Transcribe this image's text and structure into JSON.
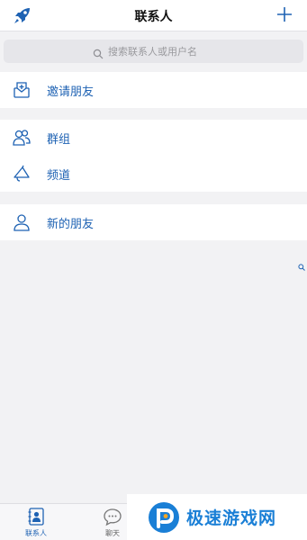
{
  "navbar": {
    "title": "联系人",
    "left_icon": "rocket-icon",
    "right_icon": "plus-icon"
  },
  "search": {
    "placeholder": "搜索联系人或用户名"
  },
  "sections": [
    {
      "items": [
        {
          "label": "邀请朋友",
          "icon": "invite-inbox-icon"
        }
      ]
    },
    {
      "items": [
        {
          "label": "群组",
          "icon": "group-users-icon"
        },
        {
          "label": "频道",
          "icon": "megaphone-icon"
        }
      ]
    },
    {
      "items": [
        {
          "label": "新的朋友",
          "icon": "person-icon"
        }
      ]
    }
  ],
  "tabbar": {
    "tabs": [
      {
        "label": "联系人",
        "icon": "contacts-book-icon",
        "active": true
      },
      {
        "label": "聊天",
        "icon": "chat-bubble-icon",
        "active": false
      }
    ]
  },
  "watermark": {
    "text": "极速游戏网"
  },
  "colors": {
    "accent": "#1e62b3",
    "background": "#f2f2f4",
    "watermark": "#1a7fd6"
  }
}
